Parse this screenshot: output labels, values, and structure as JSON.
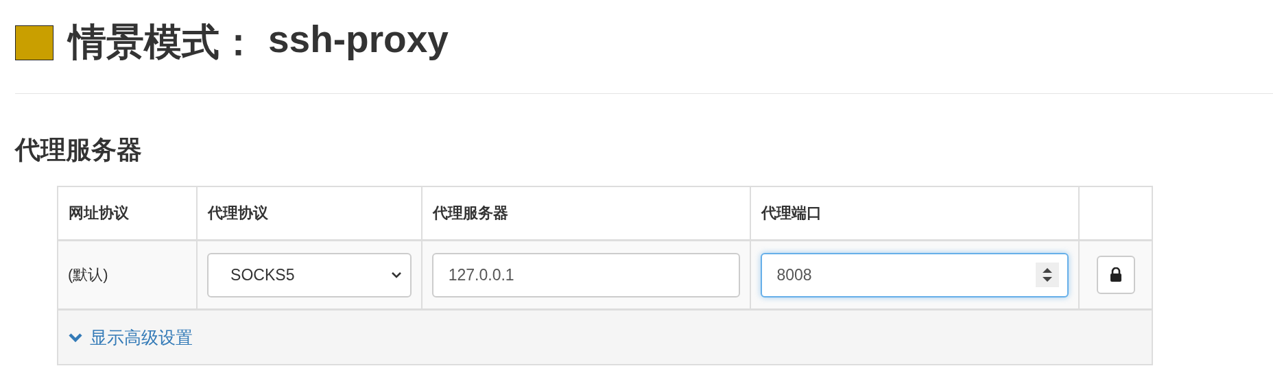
{
  "profile": {
    "label": "情景模式：",
    "name": "ssh-proxy",
    "color": "#c99f00"
  },
  "section": {
    "title": "代理服务器"
  },
  "table": {
    "columns": [
      "网址协议",
      "代理协议",
      "代理服务器",
      "代理端口"
    ],
    "rows": [
      {
        "scheme": "(默认)",
        "protocol": "SOCKS5",
        "server": "127.0.0.1",
        "port": "8008",
        "port_focused": true
      }
    ],
    "advanced_link": {
      "label": "显示高级设置",
      "expanded": false
    }
  }
}
